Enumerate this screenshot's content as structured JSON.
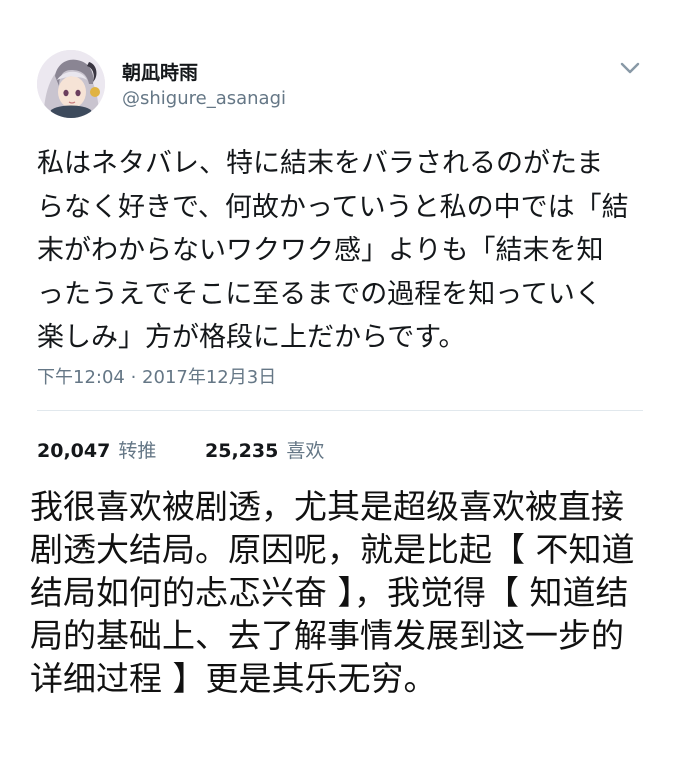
{
  "tweet": {
    "display_name": "朝凪時雨",
    "handle": "@shigure_asanagi",
    "text_lines": [
      "私はネタバレ、特に結末をバラされるのがたま",
      "らなく好きで、何故かっていうと私の中では「結",
      "末がわからないワクワク感」よりも「結末を知",
      "ったうえでそこに至るまでの過程を知っていく",
      "楽しみ」方が格段に上だからです。"
    ],
    "timestamp": "下午12:04 · 2017年12月3日",
    "retweets": {
      "count": "20,047",
      "label": "转推"
    },
    "likes": {
      "count": "25,235",
      "label": "喜欢"
    }
  },
  "caption": {
    "lines": [
      "我很喜欢被剧透，尤其是超级喜欢被直接",
      "剧透大结局。原因呢，就是比起【 不知道",
      "结局如何的忐忑兴奋 】，我觉得【 知道结",
      "局的基础上、去了解事情发展到这一步的",
      "详细过程 】更是其乐无穷。"
    ]
  },
  "icons": {
    "avatar": "anime-avatar",
    "menu": "chevron-down-icon"
  },
  "colors": {
    "secondary_text": "#657786",
    "divider": "#e1e8ed"
  }
}
